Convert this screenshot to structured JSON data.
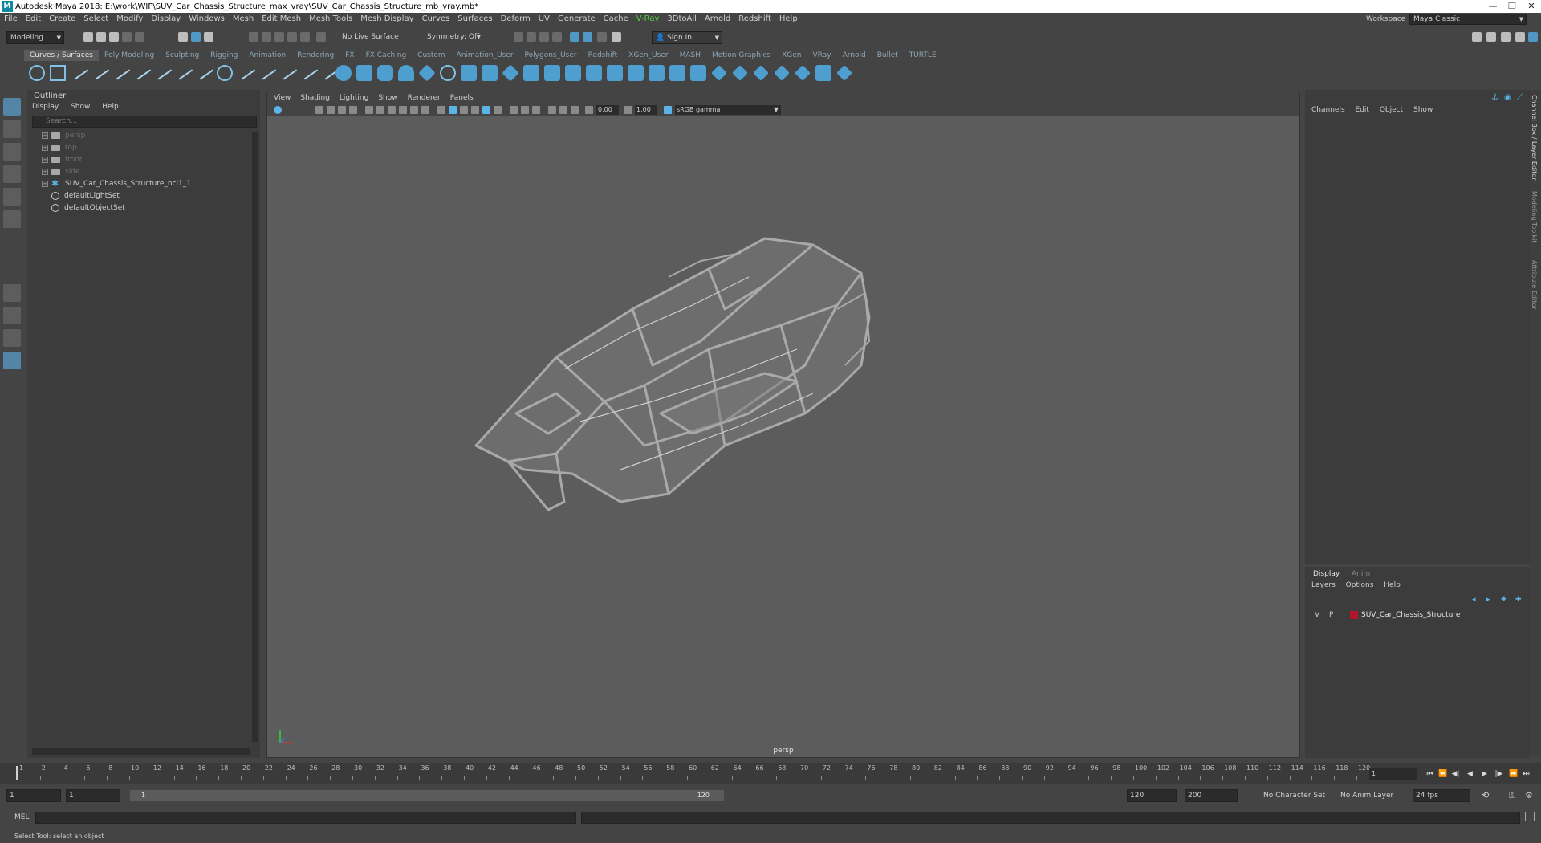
{
  "window": {
    "title": "Autodesk Maya 2018: E:\\work\\WIP\\SUV_Car_Chassis_Structure_max_vray\\SUV_Car_Chassis_Structure_mb_vray.mb*",
    "logo": "M",
    "controls": [
      "—",
      "❐",
      "✕"
    ]
  },
  "menubar": {
    "items": [
      "File",
      "Edit",
      "Create",
      "Select",
      "Modify",
      "Display",
      "Windows",
      "Mesh",
      "Edit Mesh",
      "Mesh Tools",
      "Mesh Display",
      "Curves",
      "Surfaces",
      "Deform",
      "UV",
      "Generate",
      "Cache",
      "V-Ray",
      "3DtoAll",
      "Arnold",
      "Redshift",
      "Help"
    ],
    "workspace_label": "Workspace :",
    "workspace_value": "Maya Classic"
  },
  "statusline": {
    "mode": "Modeling",
    "live_surface": "No Live Surface",
    "symmetry": "Symmetry: Off",
    "sign_in": "Sign In"
  },
  "shelf": {
    "tabs": [
      "Curves / Surfaces",
      "Poly Modeling",
      "Sculpting",
      "Rigging",
      "Animation",
      "Rendering",
      "FX",
      "FX Caching",
      "Custom",
      "Animation_User",
      "Polygons_User",
      "Redshift",
      "XGen_User",
      "MASH",
      "Motion Graphics",
      "XGen",
      "VRay",
      "Arnold",
      "Bullet",
      "TURTLE"
    ],
    "active_tab": "Curves / Surfaces"
  },
  "outliner": {
    "title": "Outliner",
    "menu": [
      "Display",
      "Show",
      "Help"
    ],
    "search_placeholder": "Search...",
    "items": [
      {
        "label": "persp",
        "type": "camera"
      },
      {
        "label": "top",
        "type": "camera"
      },
      {
        "label": "front",
        "type": "camera"
      },
      {
        "label": "side",
        "type": "camera"
      },
      {
        "label": "SUV_Car_Chassis_Structure_ncl1_1",
        "type": "group"
      },
      {
        "label": "defaultLightSet",
        "type": "set"
      },
      {
        "label": "defaultObjectSet",
        "type": "set"
      }
    ]
  },
  "viewport": {
    "menu": [
      "View",
      "Shading",
      "Lighting",
      "Show",
      "Renderer",
      "Panels"
    ],
    "field_a": "0.00",
    "field_b": "1.00",
    "color_space": "sRGB gamma",
    "camera_label": "persp"
  },
  "channelbox": {
    "menu": [
      "Channels",
      "Edit",
      "Object",
      "Show"
    ]
  },
  "layers": {
    "tabs": [
      "Display",
      "Anim"
    ],
    "menu": [
      "Layers",
      "Options",
      "Help"
    ],
    "row": {
      "v": "V",
      "p": "P",
      "name": "SUV_Car_Chassis_Structure",
      "color": "#b5162c"
    }
  },
  "sidetabs": [
    "Channel Box / Layer Editor",
    "Modeling Toolkit",
    "Attribute Editor"
  ],
  "timeline": {
    "labels": [
      "1",
      "2",
      "4",
      "6",
      "8",
      "10",
      "12",
      "14",
      "16",
      "18",
      "20",
      "22",
      "24",
      "26",
      "28",
      "30",
      "32",
      "34",
      "36",
      "38",
      "40",
      "42",
      "44",
      "46",
      "48",
      "50",
      "52",
      "54",
      "56",
      "58",
      "60",
      "62",
      "64",
      "66",
      "68",
      "70",
      "72",
      "74",
      "76",
      "78",
      "80",
      "82",
      "84",
      "86",
      "88",
      "90",
      "92",
      "94",
      "96",
      "98",
      "100",
      "102",
      "104",
      "106",
      "108",
      "110",
      "112",
      "114",
      "116",
      "118",
      "120"
    ],
    "current_frame": "1"
  },
  "range": {
    "start": "1",
    "start2": "1",
    "bar_left": "1",
    "bar_right": "120",
    "end": "120",
    "end2": "200",
    "character_set": "No Character Set",
    "anim_layer": "No Anim Layer",
    "fps": "24 fps"
  },
  "mel": {
    "label": "MEL"
  },
  "helpline": "Select Tool: select an object"
}
